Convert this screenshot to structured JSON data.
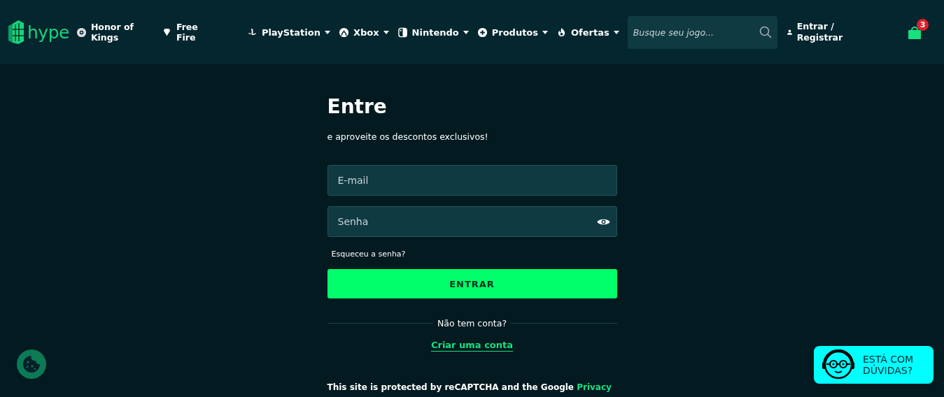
{
  "header": {
    "logo": "hype",
    "nav": [
      {
        "label": "Honor of Kings",
        "dropdown": false
      },
      {
        "label": "Free Fire",
        "dropdown": false
      },
      {
        "label": "PlayStation",
        "dropdown": true
      },
      {
        "label": "Xbox",
        "dropdown": true
      },
      {
        "label": "Nintendo",
        "dropdown": true
      },
      {
        "label": "Produtos",
        "dropdown": true
      },
      {
        "label": "Ofertas",
        "dropdown": true
      }
    ],
    "search": {
      "placeholder": "Busque seu jogo..."
    },
    "account": "Entrar / Registrar",
    "cart_count": "3"
  },
  "login": {
    "title": "Entre",
    "subtitle": "e aproveite os descontos exclusivos!",
    "fields": [
      {
        "placeholder": "E-mail",
        "kind": "text"
      },
      {
        "placeholder": "Senha",
        "kind": "password"
      }
    ],
    "forgot": "Esqueceu a senha?",
    "submit": "ENTRAR",
    "divider": "Não tem conta?",
    "signup": "Criar uma conta",
    "notice": {
      "text": "This site is protected by reCAPTCHA and the Google ",
      "link": "Privacy"
    }
  },
  "help_button": {
    "line_1": "ESTÁ COM",
    "line_2": "DÚVIDAS?"
  }
}
